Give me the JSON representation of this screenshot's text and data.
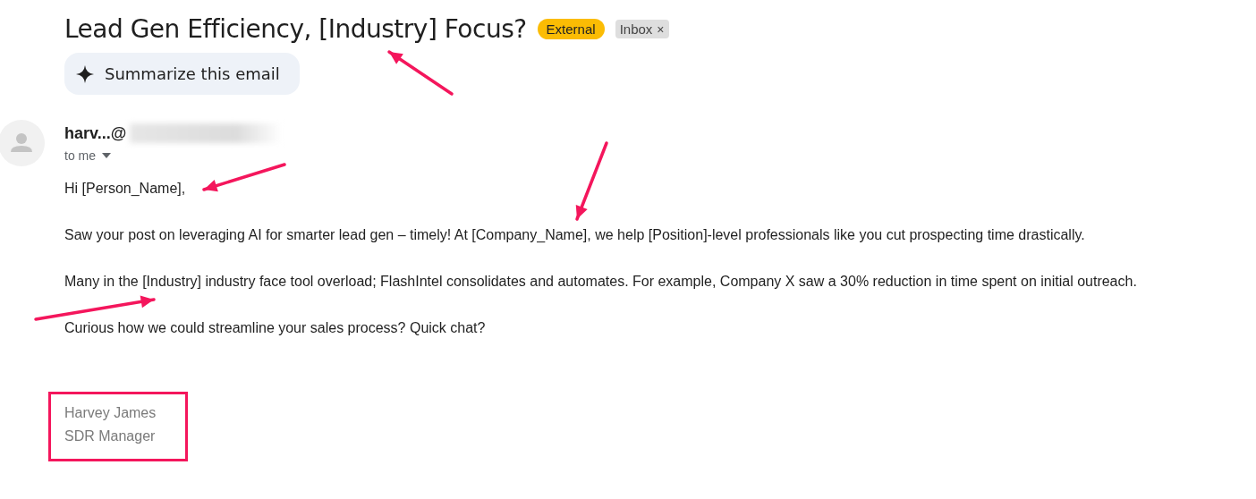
{
  "email": {
    "subject": "Lead Gen Efficiency, [Industry] Focus?",
    "labels": [
      {
        "kind": "category",
        "text": "External"
      },
      {
        "kind": "folder",
        "text": "Inbox",
        "remove": "×"
      }
    ],
    "summarize_button": "Summarize this email",
    "sender": {
      "name": "harv...@",
      "recipient": "to me"
    },
    "body": [
      "Hi [Person_Name],",
      "Saw your post on leveraging AI for smarter lead gen – timely! At [Company_Name], we help [Position]-level professionals like you cut prospecting time drastically.",
      "Many in the [Industry] industry face tool overload; FlashIntel consolidates and automates. For example, Company X saw a 30% reduction in time spent on initial outreach.",
      "Curious how we could streamline your sales process? Quick chat?"
    ],
    "signature": [
      "Harvey James",
      "SDR Manager"
    ]
  }
}
